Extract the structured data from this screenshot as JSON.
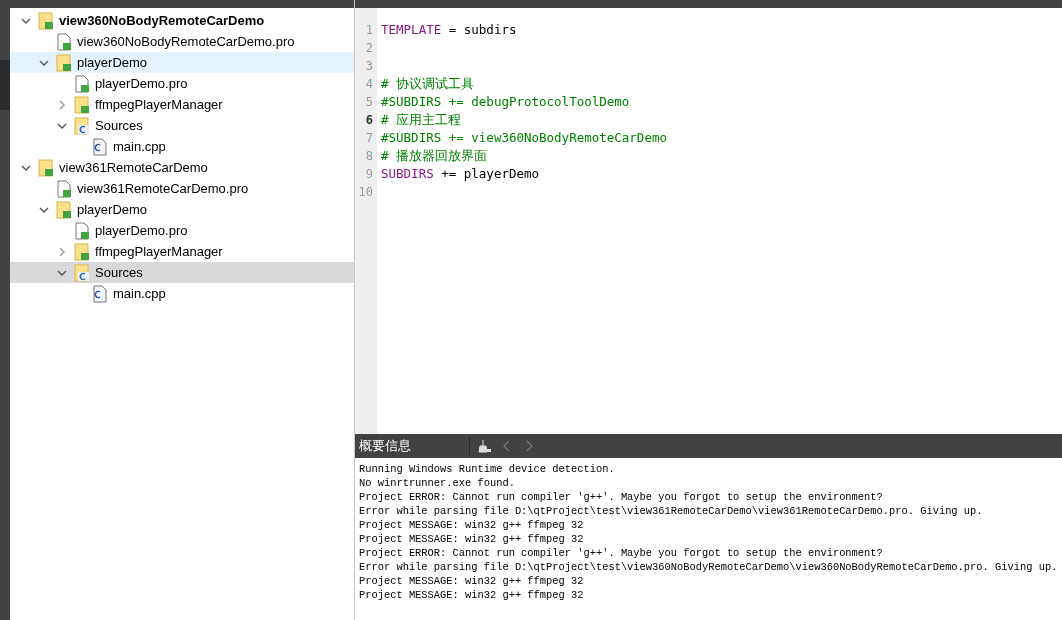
{
  "project_tree": [
    {
      "label": "view360NoBodyRemoteCarDemo",
      "kind": "project",
      "active": true,
      "expanded": true,
      "selected": false,
      "hover": false,
      "children": [
        {
          "label": "view360NoBodyRemoteCarDemo.pro",
          "kind": "pro",
          "selected": false,
          "hover": false
        },
        {
          "label": "playerDemo",
          "kind": "project",
          "active": false,
          "expanded": true,
          "selected": false,
          "hover": true,
          "children": [
            {
              "label": "playerDemo.pro",
              "kind": "pro",
              "selected": false,
              "hover": false
            },
            {
              "label": "ffmpegPlayerManager",
              "kind": "project",
              "active": false,
              "expanded": false,
              "selected": false,
              "hover": false
            },
            {
              "label": "Sources",
              "kind": "sources",
              "expanded": true,
              "selected": false,
              "hover": false,
              "children": [
                {
                  "label": "main.cpp",
                  "kind": "cpp",
                  "selected": false,
                  "hover": false
                }
              ]
            }
          ]
        }
      ]
    },
    {
      "label": "view361RemoteCarDemo",
      "kind": "project",
      "active": false,
      "expanded": true,
      "selected": false,
      "hover": false,
      "children": [
        {
          "label": "view361RemoteCarDemo.pro",
          "kind": "pro",
          "selected": false,
          "hover": false
        },
        {
          "label": "playerDemo",
          "kind": "project",
          "active": false,
          "expanded": true,
          "selected": false,
          "hover": false,
          "children": [
            {
              "label": "playerDemo.pro",
              "kind": "pro",
              "selected": false,
              "hover": false
            },
            {
              "label": "ffmpegPlayerManager",
              "kind": "project",
              "active": false,
              "expanded": false,
              "selected": false,
              "hover": false
            },
            {
              "label": "Sources",
              "kind": "sources",
              "expanded": true,
              "selected": true,
              "hover": false,
              "children": [
                {
                  "label": "main.cpp",
                  "kind": "cpp",
                  "selected": false,
                  "hover": false
                }
              ]
            }
          ]
        }
      ]
    }
  ],
  "editor": {
    "lines": [
      {
        "number": "1",
        "current": false,
        "segments": [
          {
            "kind": "keyword",
            "text": "TEMPLATE"
          },
          {
            "kind": "plain",
            "text": " = subdirs"
          }
        ]
      },
      {
        "number": "2",
        "current": false
      },
      {
        "number": "3",
        "current": false
      },
      {
        "number": "4",
        "current": false,
        "segments": [
          {
            "kind": "comment",
            "text": "# 协议调试工具"
          }
        ]
      },
      {
        "number": "5",
        "current": false,
        "segments": [
          {
            "kind": "comment",
            "text": "#SUBDIRS += debugProtocolToolDemo"
          }
        ]
      },
      {
        "number": "6",
        "current": true,
        "segments": [
          {
            "kind": "comment",
            "text": "# 应用主工程"
          }
        ]
      },
      {
        "number": "7",
        "current": false,
        "segments": [
          {
            "kind": "comment",
            "text": "#SUBDIRS += view360NoBodyRemoteCarDemo"
          }
        ]
      },
      {
        "number": "8",
        "current": false,
        "segments": [
          {
            "kind": "comment",
            "text": "# 播放器回放界面"
          }
        ]
      },
      {
        "number": "9",
        "current": false,
        "segments": [
          {
            "kind": "keyword",
            "text": "SUBDIRS"
          },
          {
            "kind": "plain",
            "text": " += playerDemo"
          }
        ]
      },
      {
        "number": "10",
        "current": false
      }
    ]
  },
  "output_pane": {
    "title": "概要信息",
    "lines": [
      "Running Windows Runtime device detection.",
      "No winrtrunner.exe found.",
      "Project ERROR: Cannot run compiler 'g++'. Maybe you forgot to setup the environment?",
      "Error while parsing file D:\\qtProject\\test\\view361RemoteCarDemo\\view361RemoteCarDemo.pro. Giving up.",
      "Project MESSAGE: win32 g++ ffmpeg 32",
      "Project MESSAGE: win32 g++ ffmpeg 32",
      "Project ERROR: Cannot run compiler 'g++'. Maybe you forgot to setup the environment?",
      "Error while parsing file D:\\qtProject\\test\\view360NoBodyRemoteCarDemo\\view360NoBodyRemoteCarDemo.pro. Giving up.",
      "Project MESSAGE: win32 g++ ffmpeg 32",
      "Project MESSAGE: win32 g++ ffmpeg 32"
    ]
  }
}
